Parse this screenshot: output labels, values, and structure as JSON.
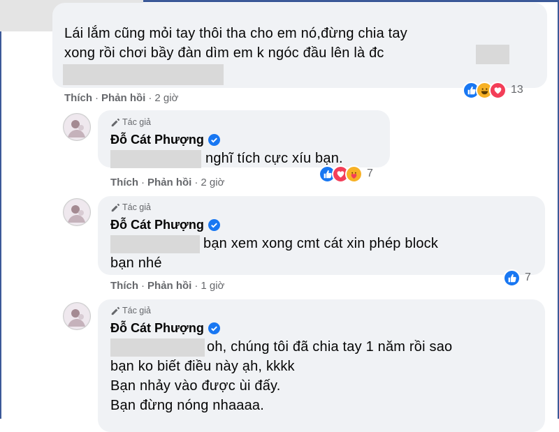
{
  "comment_top": {
    "lines": [
      "Lái lắm cũng mỏi tay thôi tha cho em nó,đừng chia tay",
      "xong rồi chơi bầy đàn dìm em k ngóc đầu lên là đc"
    ],
    "actions": {
      "like": "Thích",
      "sep": "·",
      "reply": "Phản hồi",
      "time": "2 giờ"
    },
    "reaction_count": "13",
    "reaction_icons": [
      "like-icon",
      "haha-icon",
      "love-icon"
    ]
  },
  "replies": [
    {
      "badge": "Tác giả",
      "author": "Đỗ Cát Phượng",
      "lines": [
        "nghĩ tích cực xíu bạn."
      ],
      "actions": {
        "like": "Thích",
        "sep": "·",
        "reply": "Phản hồi",
        "time": "2 giờ"
      },
      "reaction_count": "7",
      "reaction_icons": [
        "like-icon",
        "love-icon",
        "care-icon"
      ]
    },
    {
      "badge": "Tác giả",
      "author": "Đỗ Cát Phượng",
      "lines": [
        "bạn xem xong cmt cát xin phép block",
        "bạn nhé"
      ],
      "actions": {
        "like": "Thích",
        "sep": "·",
        "reply": "Phản hồi",
        "time": "1 giờ"
      },
      "reaction_count": "7",
      "reaction_icons": [
        "like-icon"
      ]
    },
    {
      "badge": "Tác giả",
      "author": "Đỗ Cát Phượng",
      "lines": [
        "oh, chúng tôi đã chia tay 1 năm rồi sao",
        "bạn ko biết điều này ạh, kkkk",
        "Bạn nhảy vào được ùi đấy.",
        "Bạn đừng nóng nhaaaa."
      ]
    }
  ],
  "colors": {
    "brand": "#1877f2",
    "bubble": "#f0f2f5",
    "muted": "#65676b"
  }
}
